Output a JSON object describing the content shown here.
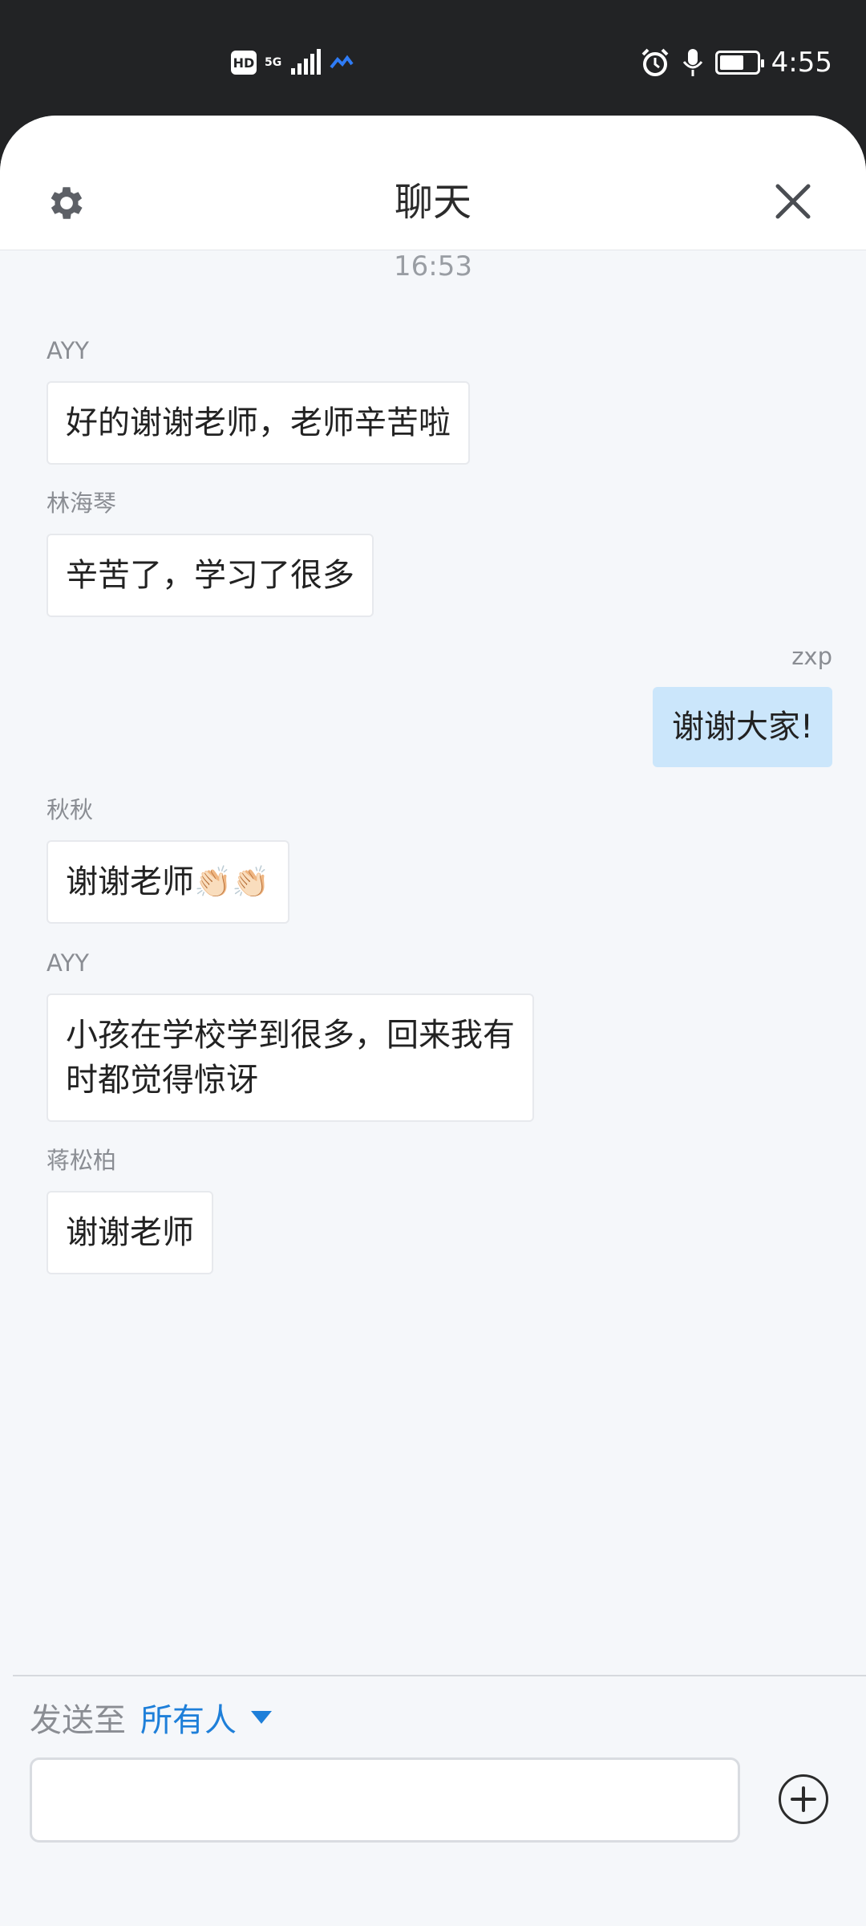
{
  "status_bar": {
    "left_icons": {
      "hd": "HD",
      "network": "5G",
      "signal": "signal-bars-icon",
      "app": "app-notification-icon"
    },
    "right_icons": {
      "alarm": "alarm-icon",
      "mic": "mic-icon",
      "battery_level": 0.65
    },
    "time": "4:55"
  },
  "header": {
    "title": "聊天",
    "settings_icon": "gear-icon",
    "close_icon": "close-icon"
  },
  "chat": {
    "timestamp": "16:53",
    "messages": [
      {
        "sender": "AYY",
        "text": "好的谢谢老师，老师辛苦啦"
      },
      {
        "sender": "林海琴",
        "text": "辛苦了，学习了很多"
      },
      {
        "sender": "zxp",
        "text": "谢谢大家!",
        "self": true
      },
      {
        "sender": "秋秋",
        "text": "谢谢老师",
        "emoji": "👏🏻👏🏻"
      },
      {
        "sender": "AYY",
        "text": "小孩在学校学到很多，回来我有\n时都觉得惊讶"
      },
      {
        "sender": "蒋松柏",
        "text": "谢谢老师"
      }
    ]
  },
  "footer": {
    "send_label": "发送至",
    "recipient": "所有人",
    "input_value": "",
    "accent": "#1e7fd9"
  }
}
